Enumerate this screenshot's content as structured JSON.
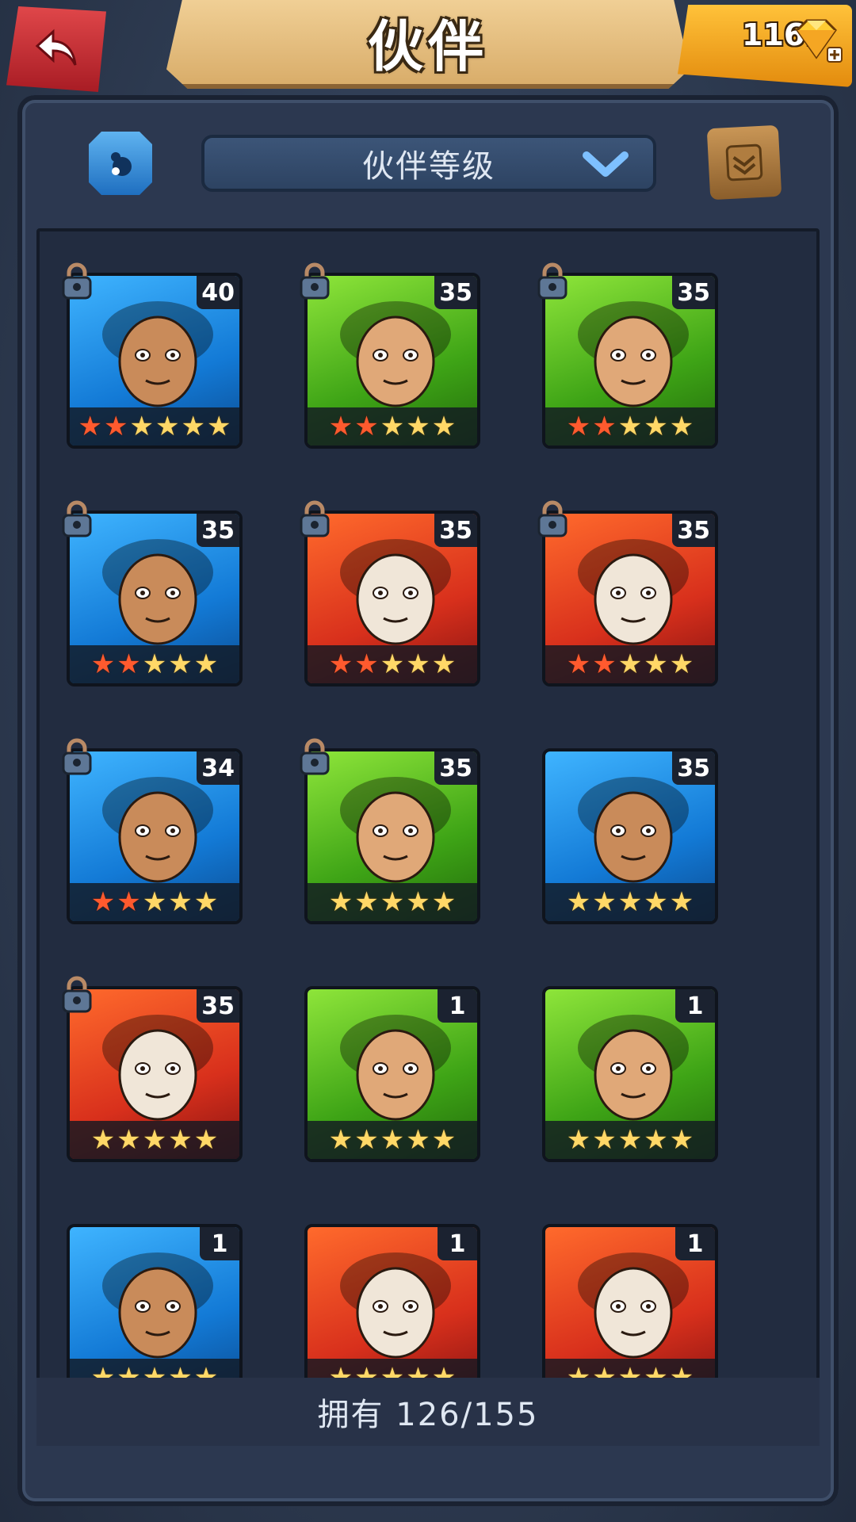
{
  "header": {
    "title": "伙伴",
    "gems": "1161"
  },
  "toolbar": {
    "sort_label": "伙伴等级"
  },
  "partners": [
    {
      "level": "40",
      "bg": "blue",
      "stars": "★★★★★★",
      "red_stars": 2,
      "locked": true,
      "portrait": "bearded-warrior"
    },
    {
      "level": "35",
      "bg": "green",
      "stars": "★★★★★",
      "red_stars": 2,
      "locked": true,
      "portrait": "dark-haired-woman"
    },
    {
      "level": "35",
      "bg": "green",
      "stars": "★★★★★",
      "red_stars": 2,
      "locked": true,
      "portrait": "crocodile"
    },
    {
      "level": "35",
      "bg": "blue",
      "stars": "★★★★★",
      "red_stars": 2,
      "locked": true,
      "portrait": "hooded-mage"
    },
    {
      "level": "35",
      "bg": "red",
      "stars": "★★★★★",
      "red_stars": 2,
      "locked": true,
      "portrait": "skull-shaman"
    },
    {
      "level": "35",
      "bg": "red",
      "stars": "★★★★★",
      "red_stars": 2,
      "locked": true,
      "portrait": "brown-haired-woman"
    },
    {
      "level": "34",
      "bg": "blue",
      "stars": "★★★★★",
      "red_stars": 2,
      "locked": true,
      "portrait": "blue-haired-woman"
    },
    {
      "level": "35",
      "bg": "green",
      "stars": "★★★★★",
      "red_stars": 0,
      "locked": true,
      "portrait": "panda"
    },
    {
      "level": "35",
      "bg": "blue",
      "stars": "★★★★★",
      "red_stars": 0,
      "locked": false,
      "portrait": "blue-haired-warrior"
    },
    {
      "level": "35",
      "bg": "red",
      "stars": "★★★★★",
      "red_stars": 0,
      "locked": true,
      "portrait": "red-panda"
    },
    {
      "level": "1",
      "bg": "green",
      "stars": "★★★★★",
      "red_stars": 0,
      "locked": false,
      "portrait": "sabertooth-green"
    },
    {
      "level": "1",
      "bg": "green",
      "stars": "★★★★★",
      "red_stars": 0,
      "locked": false,
      "portrait": "goblin"
    },
    {
      "level": "1",
      "bg": "blue",
      "stars": "★★★★★",
      "red_stars": 0,
      "locked": false,
      "portrait": "sabertooth-blue"
    },
    {
      "level": "1",
      "bg": "red",
      "stars": "★★★★★",
      "red_stars": 0,
      "locked": false,
      "portrait": "witch-doctor"
    },
    {
      "level": "1",
      "bg": "red",
      "stars": "★★★★★",
      "red_stars": 0,
      "locked": false,
      "portrait": "red-haired-woman"
    }
  ],
  "footer": {
    "owned_text": "拥有 126/155"
  },
  "colors": {
    "accent_gold": "#ffd867",
    "star_red": "#ff5a2e",
    "panel_bg": "#222c40"
  }
}
